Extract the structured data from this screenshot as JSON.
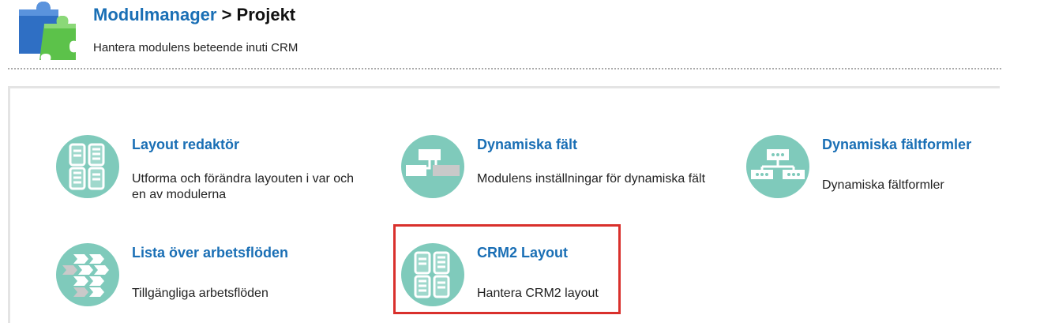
{
  "header": {
    "breadcrumb_link": "Modulmanager",
    "breadcrumb_separator": " > ",
    "breadcrumb_current": "Projekt",
    "subtitle": "Hantera modulens beteende inuti CRM",
    "icon": "puzzle-icon"
  },
  "tiles": [
    {
      "title": "Layout redaktör",
      "description": "Utforma och förändra layouten i var och en av modulerna",
      "icon": "layout-grid-icon"
    },
    {
      "title": "Dynamiska fält",
      "description": "Modulens inställningar för dynamiska fält",
      "icon": "dynamic-fields-icon"
    },
    {
      "title": "Dynamiska fältformler",
      "description": "Dynamiska fältformler",
      "icon": "field-formula-icon"
    },
    {
      "title": "Lista över arbetsflöden",
      "description": "Tillgängliga arbetsflöden",
      "icon": "workflow-arrows-icon"
    },
    {
      "title": "CRM2 Layout",
      "description": "Hantera CRM2 layout",
      "icon": "layout-grid-icon"
    }
  ],
  "colors": {
    "link": "#1a6fb5",
    "icon_circle": "#7fcabb",
    "highlight": "#d9302c"
  }
}
